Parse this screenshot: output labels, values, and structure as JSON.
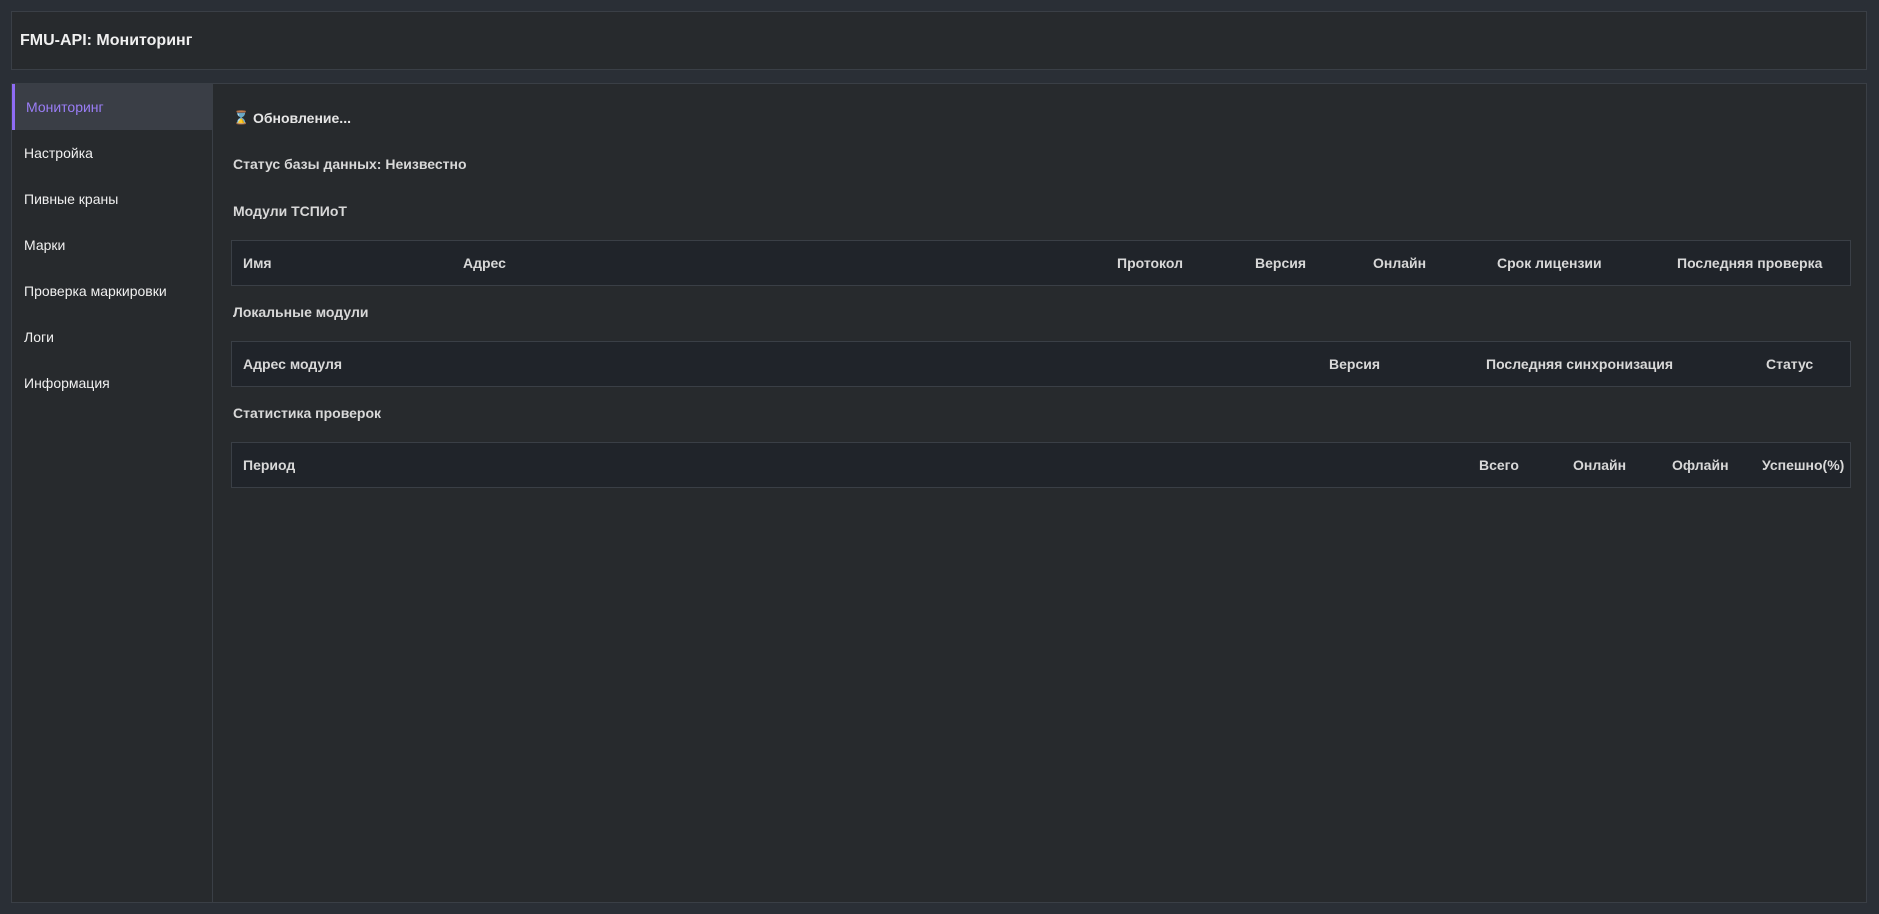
{
  "header": {
    "title": "FMU-API: Мониторинг"
  },
  "sidebar": {
    "items": [
      {
        "label": "Мониторинг",
        "active": true
      },
      {
        "label": "Настройка",
        "active": false
      },
      {
        "label": "Пивные краны",
        "active": false
      },
      {
        "label": "Марки",
        "active": false
      },
      {
        "label": "Проверка маркировки",
        "active": false
      },
      {
        "label": "Логи",
        "active": false
      },
      {
        "label": "Информация",
        "active": false
      }
    ]
  },
  "main": {
    "refresh_icon": "hourglass-icon",
    "refresh_text": "Обновление...",
    "db_status": "Статус базы данных: Неизвестно",
    "tspiot": {
      "title": "Модули ТСПИоТ",
      "columns": [
        "Имя",
        "Адрес",
        "Протокол",
        "Версия",
        "Онлайн",
        "Срок лицензии",
        "Последняя проверка"
      ]
    },
    "local_modules": {
      "title": "Локальные модули",
      "columns": [
        "Адрес модуля",
        "Версия",
        "Последняя синхронизация",
        "Статус"
      ]
    },
    "check_stats": {
      "title": "Статистика проверок",
      "columns": [
        "Период",
        "Всего",
        "Онлайн",
        "Офлайн",
        "Успешно(%)"
      ]
    }
  },
  "colors": {
    "background": "#2a2f36",
    "panel": "#272a2d",
    "table_header": "#20242a",
    "accent": "#8f6cf5"
  }
}
